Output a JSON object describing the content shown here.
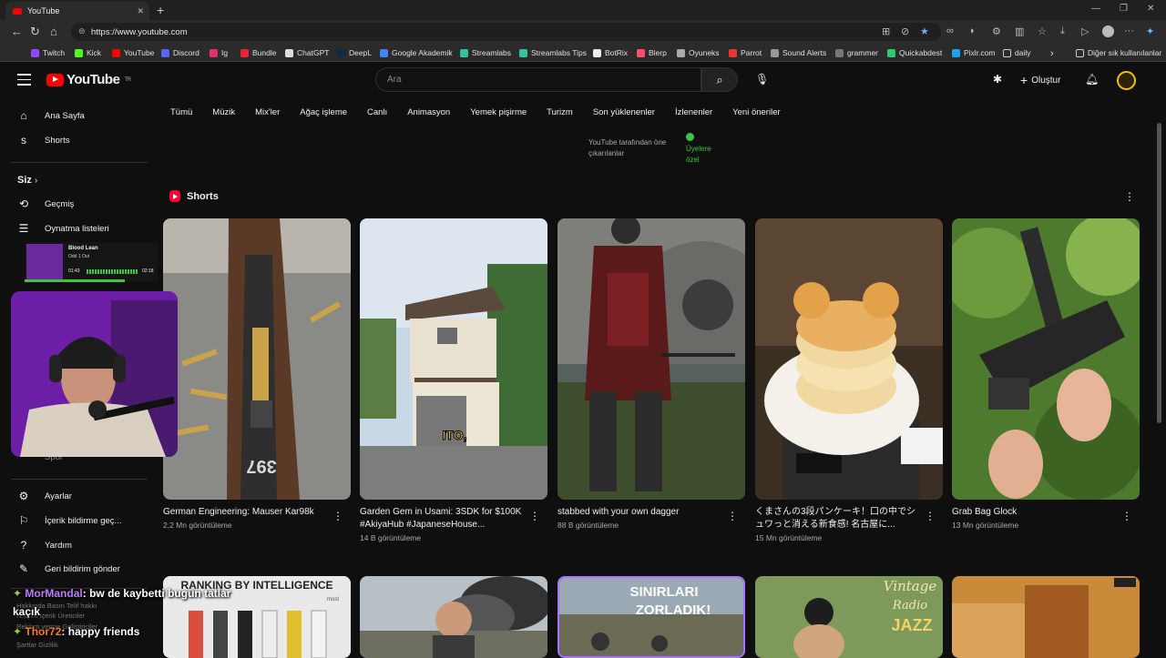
{
  "browser": {
    "tab_title": "YouTube",
    "url": "https://www.youtube.com",
    "bookmarks": [
      "Twitch",
      "Kick",
      "YouTube",
      "Discord",
      "Ig",
      "Bundle",
      "ChatGPT",
      "DeepL",
      "Google Akademik",
      "Streamlabs",
      "Streamlabs Tips",
      "BotRix",
      "Blerp",
      "Oyuneks",
      "Parrot",
      "Sound Alerts",
      "grammer",
      "Quickabdest",
      "Pixlr.com",
      "daily"
    ],
    "other_bookmarks": "Diğer sık kullanılanlar"
  },
  "header": {
    "logo_text": "YouTube",
    "region": "TR",
    "search_placeholder": "Ara",
    "create_label": "Oluştur"
  },
  "chips": [
    "Tümü",
    "Müzik",
    "Mix'ler",
    "Ağaç işleme",
    "Canlı",
    "Animasyon",
    "Yemek pişirme",
    "Turizm",
    "Son yüklenenler",
    "İzlenenler",
    "Yeni öneriler"
  ],
  "featured": {
    "label": "YouTube tarafından öne çıkarılanlar",
    "members": "Üyelere özel"
  },
  "sidebar": {
    "home": "Ana Sayfa",
    "shorts": "Shorts",
    "you": "Siz",
    "history": "Geçmiş",
    "playlists": "Oynatma listeleri",
    "sports": "Spor",
    "settings": "Ayarlar",
    "report_history": "İçerik bildirme geç...",
    "help": "Yardım",
    "feedback": "Geri bildirim gönder",
    "footer1": "Hakkında  Basın  Telif hakkı",
    "footer2": "İletişim  İçerik Üreticiler",
    "footer3": "Reklam verme  Geliştiriciler",
    "footer4": "Şartlar  Gizlilik"
  },
  "shorts": {
    "section_title": "Shorts",
    "items": [
      {
        "title": "German Engineering: Mauser Kar98k",
        "views": "2,2 Mn görüntüleme"
      },
      {
        "title": "Garden Gem in Usami: 3SDK for $100K #AkiyaHub #JapaneseHouse...",
        "views": "14 B görüntüleme"
      },
      {
        "title": "stabbed with your own dagger",
        "views": "88 B görüntüleme"
      },
      {
        "title": "くまさんの3段パンケーキ！口の中でシュワっと消える新食感! 名古屋に...",
        "views": "15 Mn görüntüleme"
      },
      {
        "title": "Grab Bag Glock",
        "views": "13 Mn görüntüleme"
      }
    ]
  },
  "row2": {
    "thumb1_text": "RANKING BY INTELLIGENCE",
    "thumb1_sub": "most",
    "thumb3_text1": "SINIRLARI",
    "thumb3_text2": "ZORLADIK!",
    "thumb4_text1": "Vintage",
    "thumb4_text2": "Radio",
    "thumb4_text3": "JAZZ"
  },
  "thumb_overlay": {
    "ito": "ITO,",
    "rifle_mark": "397"
  },
  "overlay": {
    "song_title": "Blood Lean",
    "song_artist": "Odd 1 Out",
    "time_current": "01:43",
    "time_total": "02:18",
    "chat1_user": "MorMandal",
    "chat1_msg": ": bw de kaybetti bugün tatlar",
    "chat1_cont": "kaçık",
    "chat2_user": "Thor72",
    "chat2_msg": ": happy friends"
  },
  "colors": {
    "yt_red": "#ff0000",
    "accent_green": "#3ec43e",
    "chat_user_purple": "#c07cff",
    "chat_user_orange": "#ff7a1a"
  }
}
